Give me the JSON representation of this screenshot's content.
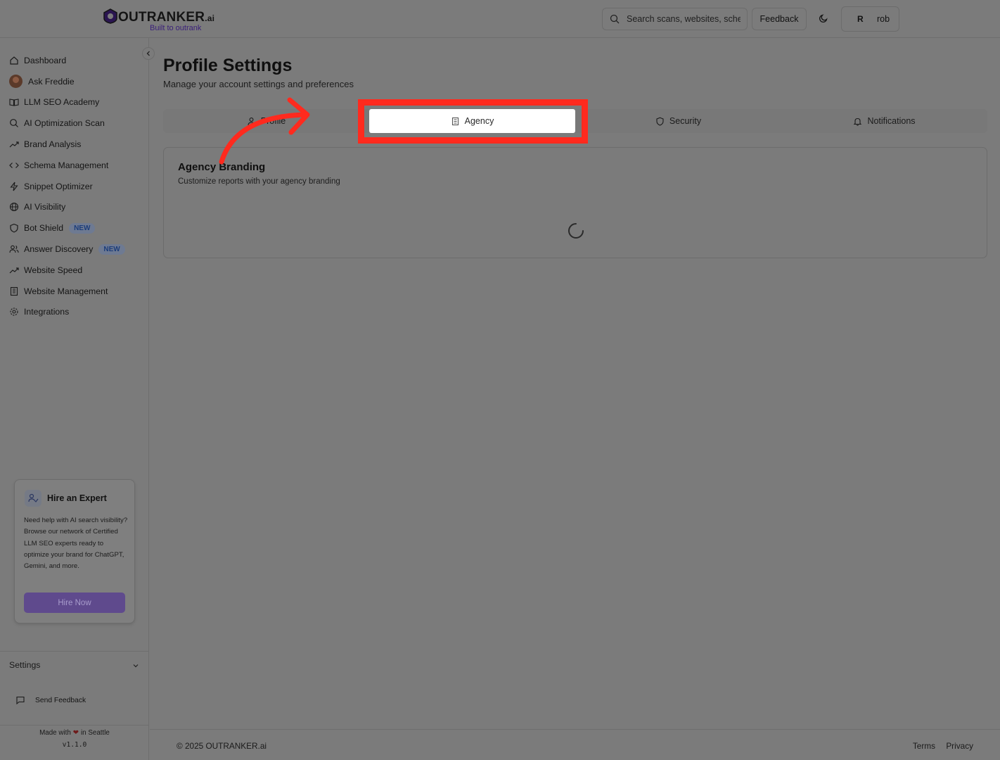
{
  "brand": {
    "name_main": "OUTRANKER",
    "name_suffix": ".ai",
    "tagline": "Built to outrank"
  },
  "header": {
    "search_placeholder": "Search scans, websites, schema...",
    "feedback_label": "Feedback",
    "theme_icon": "moon-icon",
    "user_initial": "R",
    "user_name": "rob"
  },
  "sidebar": {
    "items": [
      {
        "label": "Dashboard",
        "icon": "home-icon"
      },
      {
        "label": "Ask Freddie",
        "icon": "avatar"
      },
      {
        "label": "LLM SEO Academy",
        "icon": "book-open-icon"
      },
      {
        "label": "AI Optimization Scan",
        "icon": "search-icon"
      },
      {
        "label": "Brand Analysis",
        "icon": "trending-up-icon"
      },
      {
        "label": "Schema Management",
        "icon": "code-icon"
      },
      {
        "label": "Snippet Optimizer",
        "icon": "zap-icon"
      },
      {
        "label": "AI Visibility",
        "icon": "globe-icon"
      },
      {
        "label": "Bot Shield",
        "icon": "shield-icon",
        "badge": "NEW"
      },
      {
        "label": "Answer Discovery",
        "icon": "users-icon",
        "badge": "NEW"
      },
      {
        "label": "Website Speed",
        "icon": "trending-up-icon"
      },
      {
        "label": "Website Management",
        "icon": "building-icon"
      },
      {
        "label": "Integrations",
        "icon": "gear-icon"
      }
    ],
    "expert": {
      "title": "Hire an Expert",
      "body": "Need help with AI search visibility? Browse our network of Certified LLM SEO experts ready to optimize your brand for ChatGPT, Gemini, and more.",
      "button": "Hire Now"
    },
    "settings_label": "Settings",
    "send_feedback_label": "Send Feedback",
    "made_with_prefix": "Made with",
    "made_with_suffix": "in Seattle",
    "version": "v1.1.0"
  },
  "main": {
    "title": "Profile Settings",
    "subtitle": "Manage your account settings and preferences",
    "tabs": [
      {
        "label": "Profile",
        "icon": "user-icon",
        "active": false
      },
      {
        "label": "Agency",
        "icon": "building-icon",
        "active": true
      },
      {
        "label": "Security",
        "icon": "shield-icon",
        "active": false
      },
      {
        "label": "Notifications",
        "icon": "bell-icon",
        "active": false
      }
    ],
    "card": {
      "title": "Agency Branding",
      "subtitle": "Customize reports with your agency branding"
    }
  },
  "footer": {
    "copyright": "© 2025 OUTRANKER.ai",
    "links": [
      "Terms",
      "Privacy"
    ]
  },
  "annotation": {
    "highlight_color": "#ff2a1e"
  }
}
